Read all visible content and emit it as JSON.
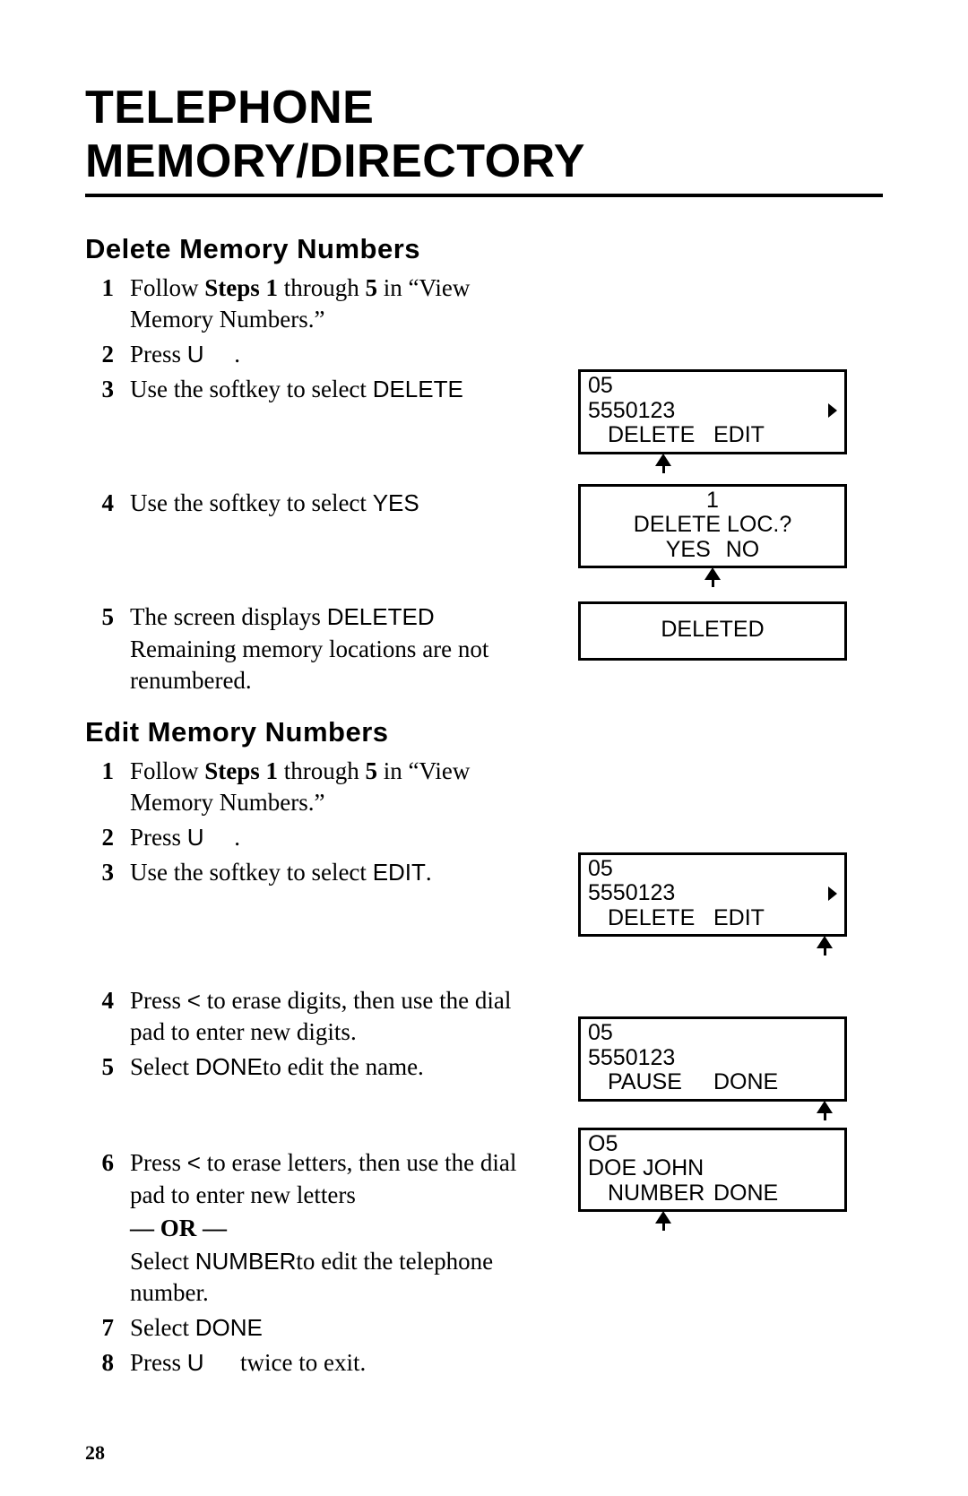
{
  "title": "TELEPHONE MEMORY/DIRECTORY",
  "page_number": "28",
  "sections": {
    "delete": {
      "heading": "Delete Memory Numbers",
      "steps": [
        {
          "n": "1",
          "pre": "Follow ",
          "b1": "Steps 1 ",
          "mid": "through ",
          "b2": "5 ",
          "post": "in “View Memory Numbers.”"
        },
        {
          "n": "2",
          "pre": "Press ",
          "sans": "U",
          "post": "."
        },
        {
          "n": "3",
          "pre": "Use the softkey to select ",
          "sans": "DELETE",
          "post": ""
        },
        {
          "n": "4",
          "pre": "Use the softkey to select ",
          "sans": "YES",
          "post": ""
        },
        {
          "n": "5",
          "pre": "The screen displays ",
          "sans": "DELETED",
          "post": " Remaining memory locations are not renumbered."
        }
      ],
      "lcd1": {
        "line1": "05",
        "line2": "5550123",
        "soft1": "DELETE",
        "soft2": "EDIT"
      },
      "lcd2": {
        "line1": "1",
        "line2": "DELETE LOC.?",
        "opt1": "YES",
        "opt2": "NO"
      },
      "lcd3": {
        "text": "DELETED"
      }
    },
    "edit": {
      "heading": "Edit Memory Numbers",
      "steps": [
        {
          "n": "1",
          "pre": "Follow ",
          "b1": "Steps 1 ",
          "mid": "through ",
          "b2": "5 ",
          "post": "in “View Memory Numbers.”"
        },
        {
          "n": "2",
          "pre": "Press ",
          "sans": "U",
          "post": "."
        },
        {
          "n": "3",
          "pre": "Use the softkey to select ",
          "sans": "EDIT",
          "post": "."
        },
        {
          "n": "4",
          "pre": "Press ",
          "sans": "<",
          "post": " to erase digits, then use the dial pad to enter new digits."
        },
        {
          "n": "5",
          "pre": "Select ",
          "sans": "DONE",
          "post": "to edit the name."
        },
        {
          "n": "6",
          "pre": "Press ",
          "sans": "<",
          "post": " to erase letters, then use the dial pad to enter new letters",
          "or": "— OR —",
          "alt_pre": "Select ",
          "alt_sans": "NUMBER",
          "alt_post": "to edit the telephone number."
        },
        {
          "n": "7",
          "pre": "Select ",
          "sans": "DONE",
          "post": ""
        },
        {
          "n": "8",
          "pre": "Press ",
          "sans": "U",
          "post": " twice to exit."
        }
      ],
      "lcd1": {
        "line1": "05",
        "line2": "5550123",
        "soft1": "DELETE",
        "soft2": "EDIT"
      },
      "lcd2": {
        "line1": "05",
        "line2": "5550123",
        "soft1": "PAUSE",
        "soft2": "DONE"
      },
      "lcd3": {
        "line1": "O5",
        "line2": "DOE JOHN",
        "soft1": "NUMBER",
        "soft2": "DONE"
      }
    }
  }
}
